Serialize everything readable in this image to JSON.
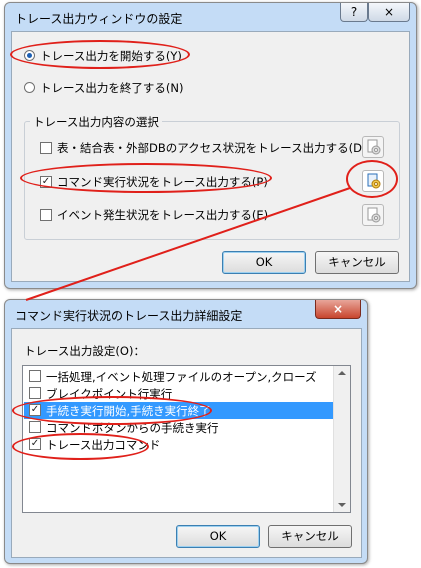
{
  "dialog1": {
    "title": "トレース出力ウィンドウの設定",
    "help_label": "?",
    "close_label": "×",
    "radio_start": "トレース出力を開始する(Y)",
    "radio_stop": "トレース出力を終了する(N)",
    "start_selected": true,
    "group_title": "トレース出力内容の選択",
    "items": [
      {
        "label": "表・結合表・外部DBのアクセス状況をトレース出力する(D)",
        "checked": false,
        "mark": ""
      },
      {
        "label": "コマンド実行状況をトレース出力する(P)",
        "checked": true,
        "mark": "✓"
      },
      {
        "label": "イベント発生状況をトレース出力する(E)",
        "checked": false,
        "mark": ""
      }
    ],
    "ok_label": "OK",
    "cancel_label": "キャンセル"
  },
  "dialog2": {
    "title": "コマンド実行状況のトレース出力詳細設定",
    "close_label": "×",
    "list_label": "トレース出力設定(O)：",
    "items": [
      {
        "label": "一括処理,イベント処理ファイルのオープン,クローズ",
        "checked": false,
        "mark": ""
      },
      {
        "label": "ブレイクポイント行実行",
        "checked": false,
        "mark": ""
      },
      {
        "label": "手続き実行開始,手続き実行終了",
        "checked": true,
        "mark": "✓",
        "selected": true
      },
      {
        "label": "コマンドボタンからの手続き実行",
        "checked": false,
        "mark": ""
      },
      {
        "label": "トレース出力コマンド",
        "checked": true,
        "mark": "✓"
      }
    ],
    "ok_label": "OK",
    "cancel_label": "キャンセル"
  },
  "colors": {
    "annotation": "#e0201a",
    "selection": "#3399ff",
    "window_frame": "#c4dcf6"
  }
}
